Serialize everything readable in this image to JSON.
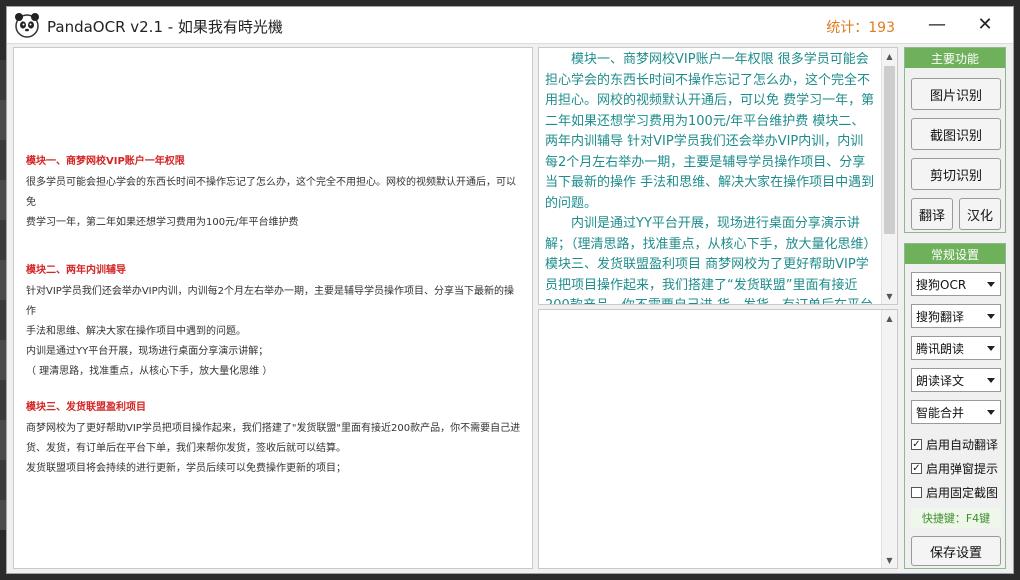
{
  "titlebar": {
    "title": "PandaOCR v2.1  -  如果我有時光機",
    "stats": "统计：193",
    "min_symbol": "—",
    "close_symbol": "✕"
  },
  "left_pane": {
    "sections": [
      {
        "title": "模块一、商梦网校VIP账户一年权限",
        "lines": [
          "很多学员可能会担心学会的东西长时间不操作忘记了怎么办，这个完全不用担心。网校的视频默认开通后，可以免",
          "费学习一年，第二年如果还想学习费用为100元/年平台维护费"
        ]
      },
      {
        "title": "模块二、两年内训辅导",
        "lines": [
          "针对VIP学员我们还会举办VIP内训，内训每2个月左右举办一期，主要是辅导学员操作项目、分享当下最新的操作",
          "手法和思维、解决大家在操作项目中遇到的问题。",
          "内训是通过YY平台开展，现场进行桌面分享演示讲解；",
          "（ 理清思路，找准重点，从核心下手，放大量化思维 ）"
        ]
      },
      {
        "title": "模块三、发货联盟盈利项目",
        "lines": [
          "商梦网校为了更好帮助VIP学员把项目操作起来，我们搭建了\"发货联盟\"里面有接近200款产品，你不需要自己进",
          "货、发货，有订单后在平台下单，我们来帮你发货，签收后就可以结算。",
          "发货联盟项目将会持续的进行更新，学员后续可以免费操作更新的项目；"
        ]
      }
    ]
  },
  "ocr_pane": {
    "paragraphs": [
      "模块一、商梦网校VIP账户一年权限 很多学员可能会担心学会的东西长时间不操作忘记了怎么办，这个完全不用担心。网校的视频默认开通后，可以免 费学习一年，第二年如果还想学习费用为100元/年平台维护费 模块二、两年内训辅导 针对VIP学员我们还会举办VIP内训，内训每2个月左右举办一期，主要是辅导学员操作项目、分享当下最新的操作 手法和思维、解决大家在操作项目中遇到的问题。",
      "内训是通过YY平台开展，现场进行桌面分享演示讲解；（理清思路，找准重点，从核心下手，放大量化思维）模块三、发货联盟盈利项目 商梦网校为了更好帮助VIP学员把项目操作起来，我们搭建了“发货联盟”里面有接近200款产品，你不需要自己进 货、发货，有订单后在平台下单"
    ]
  },
  "main_panel": {
    "header": "主要功能",
    "image_ocr": "图片识别",
    "screenshot_ocr": "截图识别",
    "clipboard_ocr": "剪切识别",
    "translate": "翻译",
    "localize": "汉化"
  },
  "settings_panel": {
    "header": "常规设置",
    "ocr_engine": "搜狗OCR",
    "translate_engine": "搜狗翻译",
    "tts_engine": "腾讯朗读",
    "read_mode": "朗读译文",
    "merge_mode": "智能合并",
    "checks": [
      {
        "label": "启用自动翻译",
        "checked": true,
        "mark": "✓"
      },
      {
        "label": "启用弹窗提示",
        "checked": true,
        "mark": "✓"
      },
      {
        "label": "启用固定截图",
        "checked": false,
        "mark": ""
      }
    ],
    "hotkey": "快捷键：F4键",
    "save": "保存设置"
  },
  "colors": {
    "accent_green": "#6fb05a",
    "ocr_text": "#1f8c8c",
    "section_red": "#d42424",
    "stats_orange": "#e07b20"
  }
}
